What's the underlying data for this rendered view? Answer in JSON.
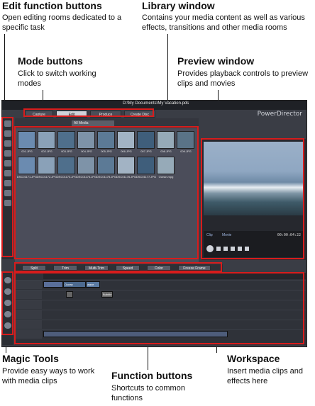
{
  "callouts": {
    "edit_function_buttons": {
      "title": "Edit function buttons",
      "desc": "Open editing rooms dedicated to a specific task"
    },
    "library_window": {
      "title": "Library window",
      "desc": "Contains your media content as well as various effects, transitions and other media rooms"
    },
    "mode_buttons": {
      "title": "Mode buttons",
      "desc": "Click to switch working modes"
    },
    "preview_window": {
      "title": "Preview window",
      "desc": "Provides playback controls to preview clips and movies"
    },
    "magic_tools": {
      "title": "Magic Tools",
      "desc": "Provide easy ways to work with media clips"
    },
    "function_buttons": {
      "title": "Function buttons",
      "desc": "Shortcuts to common functions"
    },
    "workspace": {
      "title": "Workspace",
      "desc": "Insert media clips and effects here"
    }
  },
  "app": {
    "title": "D:\\My Documents\\My Vacation.pds",
    "brand": "PowerDirector",
    "modes": [
      "Capture",
      "Edit",
      "Produce",
      "Create Disc"
    ],
    "active_mode": "Edit",
    "library_filter": "All Media",
    "library_items": [
      "001.JPG",
      "002.JPG",
      "003.JPG",
      "004.JPG",
      "005.JPG",
      "006.JPG",
      "007.JPG",
      "008.JPG",
      "009.JPG",
      "DSC01171.JPG",
      "DSC01172.JPG",
      "DSC01173.JPG",
      "DSC01174.JPG",
      "DSC01175.JPG",
      "DSC01176.JPG",
      "DSC01177.JPG",
      "Ocean.mpg"
    ],
    "function_buttons": [
      "Split",
      "Trim",
      "Multi-Trim",
      "Speed",
      "Color",
      "Freeze Frame"
    ],
    "timecode": "00:00:04:22",
    "preview_modes": [
      "Clip",
      "Movie"
    ],
    "clips": [
      "Ocean",
      "wave"
    ],
    "subclip": "Bubble",
    "colors": {
      "accent_red": "#d81c1c",
      "app_bg": "#3a3d45"
    }
  }
}
